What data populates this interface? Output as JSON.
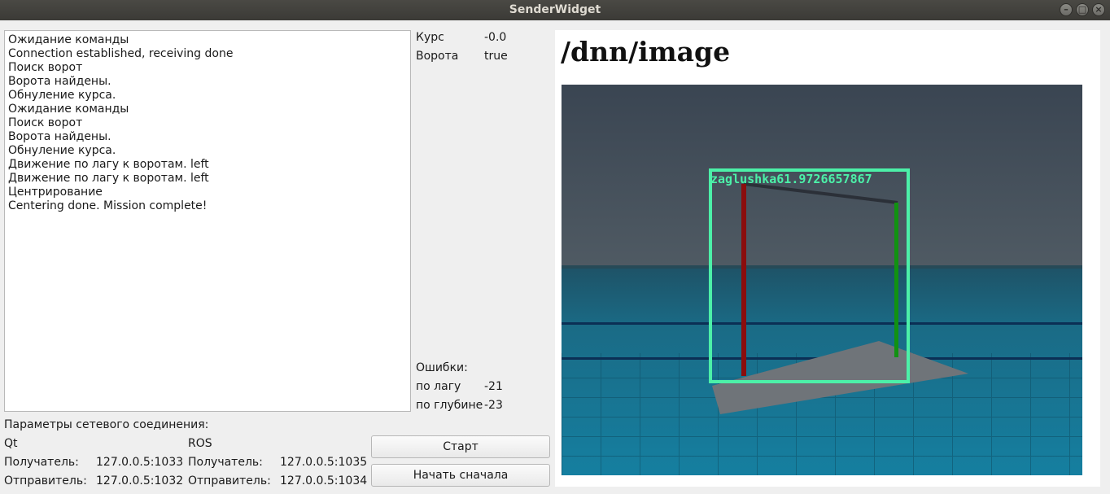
{
  "window": {
    "title": "SenderWidget"
  },
  "log": {
    "lines": [
      "Ожидание команды",
      "Connection established, receiving done",
      "Поиск ворот",
      "Ворота найдены.",
      "Обнуление курса.",
      "Ожидание команды",
      "Поиск ворот",
      "Ворота найдены.",
      "Обнуление курса.",
      "Движение по лагу к воротам. left",
      "Движение по лагу к воротам. left",
      "Центрирование",
      "Centering done. Mission complete!"
    ]
  },
  "status": {
    "course_label": "Курс",
    "course_value": "-0.0",
    "gates_label": "Ворота",
    "gates_value": "true",
    "errors_label": "Ошибки:",
    "lag_label": "по лагу",
    "lag_value": "-21",
    "depth_label": "по глубине",
    "depth_value": "-23"
  },
  "network": {
    "title": "Параметры сетевого соединения:",
    "qt": {
      "header": "Qt",
      "receiver_label": "Получатель:",
      "receiver_value": "127.0.0.5:1033",
      "sender_label": "Отправитель:",
      "sender_value": "127.0.0.5:1032"
    },
    "ros": {
      "header": "ROS",
      "receiver_label": "Получатель:",
      "receiver_value": "127.0.0.5:1035",
      "sender_label": "Отправитель:",
      "sender_value": "127.0.0.5:1034"
    }
  },
  "buttons": {
    "start": "Старт",
    "restart": "Начать сначала"
  },
  "image_view": {
    "topic": "/dnn/image",
    "detection_label": "zaglushka61.9726657867",
    "detection_color": "#4cf0a8"
  }
}
